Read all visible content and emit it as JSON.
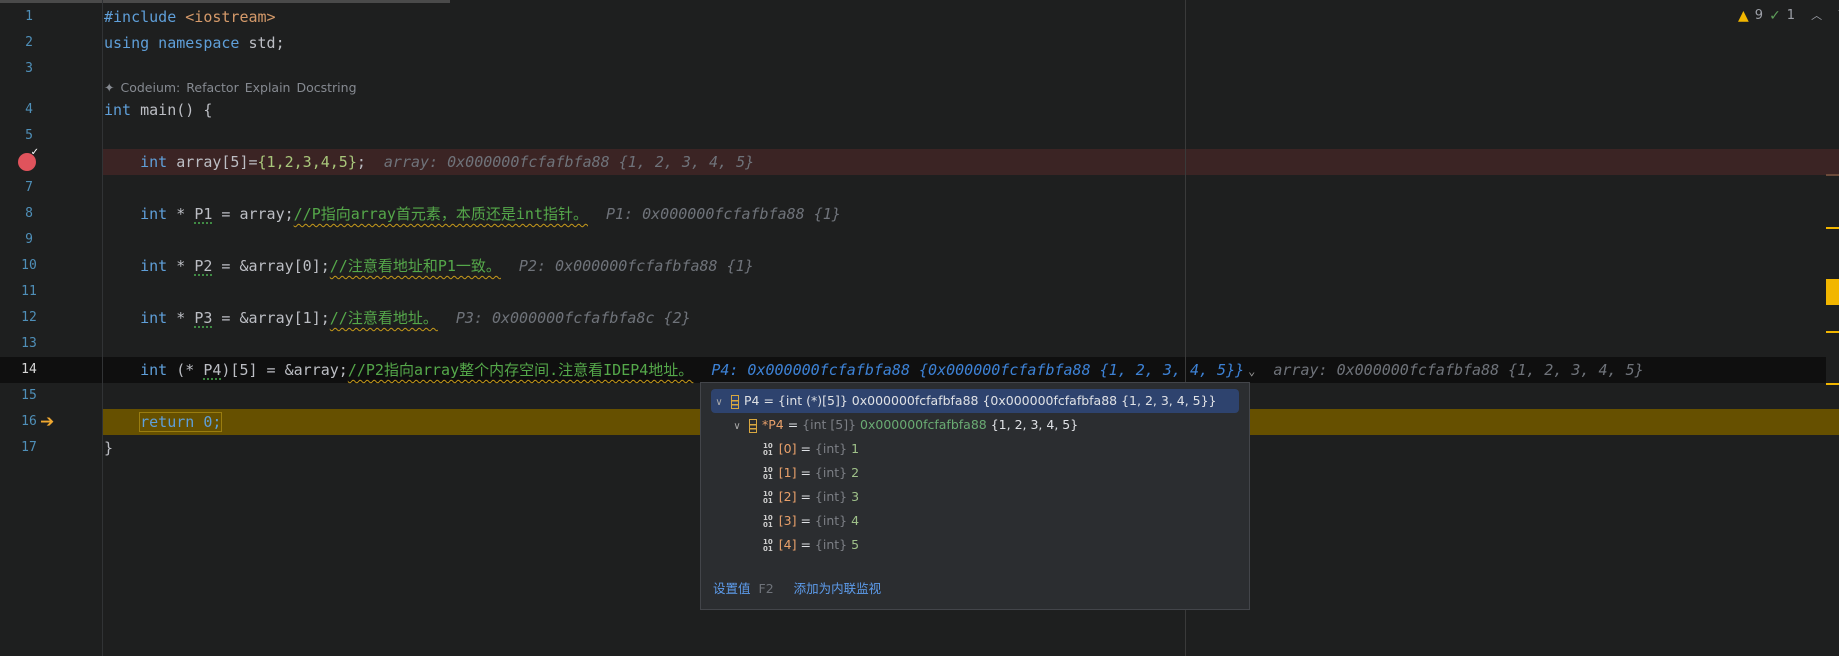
{
  "status": {
    "warnings": "9",
    "checks": "1",
    "warning_icon": "warning-triangle-icon",
    "check_icon": "check-icon"
  },
  "codeium": {
    "label": "Codeium:",
    "actions": [
      "Refactor",
      "Explain",
      "Docstring"
    ]
  },
  "lines": [
    {
      "n": "1",
      "tokens": [
        {
          "t": "#include ",
          "k": "kw"
        },
        {
          "t": "<iostream>",
          "k": "str"
        }
      ]
    },
    {
      "n": "2",
      "tokens": [
        {
          "t": "using namespace ",
          "k": "kw"
        },
        {
          "t": "std;",
          "k": "txt"
        }
      ]
    },
    {
      "n": "3",
      "tokens": []
    },
    {
      "n": "4",
      "tokens": [
        {
          "t": "int ",
          "k": "kw"
        },
        {
          "t": "main() {",
          "k": "txt"
        }
      ]
    },
    {
      "n": "5",
      "tokens": []
    },
    {
      "n": "",
      "state": "breakpoint",
      "tokens": [
        {
          "t": "    int ",
          "k": "kw"
        },
        {
          "t": "array[5]=",
          "k": "txt"
        },
        {
          "t": "{1,2,3,4,5}",
          "k": "num"
        },
        {
          "t": ";",
          "k": "txt"
        }
      ],
      "hints": [
        {
          "t": "array: 0x000000fcfafbfa88 {1, 2, 3, 4, 5}"
        }
      ]
    },
    {
      "n": "7",
      "tokens": []
    },
    {
      "n": "8",
      "tokens": [
        {
          "t": "    int ",
          "k": "kw"
        },
        {
          "t": "* ",
          "k": "txt"
        },
        {
          "t": "P1",
          "k": "var"
        },
        {
          "t": " = array;",
          "k": "txt"
        },
        {
          "t": "//P指向array首元素，本质还是int指针。",
          "k": "cmt"
        }
      ],
      "hints": [
        {
          "t": "P1: 0x000000fcfafbfa88 {1}"
        }
      ]
    },
    {
      "n": "9",
      "tokens": []
    },
    {
      "n": "10",
      "tokens": [
        {
          "t": "    int ",
          "k": "kw"
        },
        {
          "t": "* ",
          "k": "txt"
        },
        {
          "t": "P2",
          "k": "var"
        },
        {
          "t": " = &array[0];",
          "k": "txt"
        },
        {
          "t": "//注意看地址和P1一致。",
          "k": "cmt"
        }
      ],
      "hints": [
        {
          "t": "P2: 0x000000fcfafbfa88 {1}"
        }
      ]
    },
    {
      "n": "11",
      "tokens": []
    },
    {
      "n": "12",
      "tokens": [
        {
          "t": "    int ",
          "k": "kw"
        },
        {
          "t": "* ",
          "k": "txt"
        },
        {
          "t": "P3",
          "k": "var"
        },
        {
          "t": " = &array[1];",
          "k": "txt"
        },
        {
          "t": "//注意看地址。",
          "k": "cmt"
        }
      ],
      "hints": [
        {
          "t": "P3: 0x000000fcfafbfa8c {2}"
        }
      ]
    },
    {
      "n": "13",
      "tokens": []
    },
    {
      "n": "14",
      "state": "current",
      "tokens": [
        {
          "t": "    int ",
          "k": "kw"
        },
        {
          "t": "(* ",
          "k": "txt"
        },
        {
          "t": "P4",
          "k": "var"
        },
        {
          "t": ")[5] = &array;",
          "k": "txt"
        },
        {
          "t": "//P2指向array整个内存空间.注意看IDEP4地址。",
          "k": "cmt"
        }
      ],
      "hints": [
        {
          "t": "P4: 0x000000fcfafbfa88 {0x000000fcfafbfa88 {1, 2, 3, 4, 5}}",
          "blue": true,
          "chevron": "⌄"
        },
        {
          "t": "array: 0x000000fcfafbfa88 {1, 2, 3, 4, 5}"
        }
      ]
    },
    {
      "n": "15",
      "tokens": []
    },
    {
      "n": "16",
      "state": "execution",
      "tokens": [
        {
          "t": "    ",
          "k": "txt"
        },
        {
          "t": "return 0;",
          "k": "ret"
        }
      ]
    },
    {
      "n": "17",
      "tokens": [
        {
          "t": "}",
          "k": "txt"
        }
      ]
    }
  ],
  "popup": {
    "root": {
      "name": "P4",
      "eq": " = ",
      "type": "{int (*)[5]}",
      "value": " 0x000000fcfafbfa88 {0x000000fcfafbfa88 {1, 2, 3, 4, 5}}"
    },
    "deref": {
      "name": "*P4",
      "eq": " = ",
      "type": "{int [5]}",
      "addr": " 0x000000fcfafbfa88",
      "value": " {1, 2, 3, 4, 5}"
    },
    "elements": [
      {
        "name": "[0]",
        "type": "{int}",
        "value": "1"
      },
      {
        "name": "[1]",
        "type": "{int}",
        "value": "2"
      },
      {
        "name": "[2]",
        "type": "{int}",
        "value": "3"
      },
      {
        "name": "[3]",
        "type": "{int}",
        "value": "4"
      },
      {
        "name": "[4]",
        "type": "{int}",
        "value": "5"
      }
    ],
    "footer": {
      "set_value": "设置值",
      "set_value_key": "F2",
      "add_watch": "添加为内联监视"
    }
  }
}
